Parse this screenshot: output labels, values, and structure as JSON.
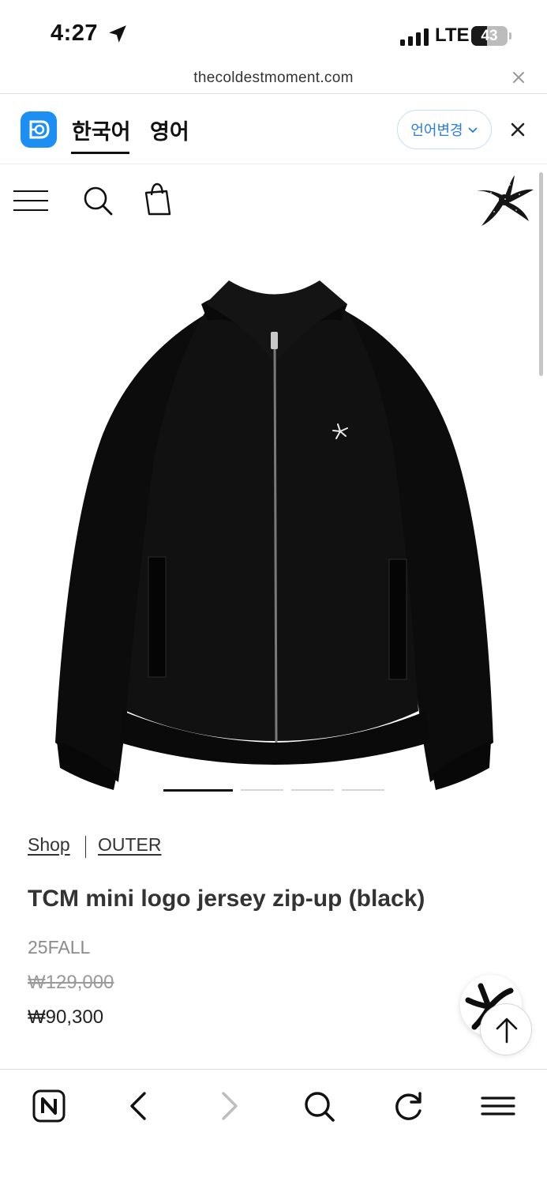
{
  "status_bar": {
    "time": "4:27",
    "network": "LTE",
    "battery": "43",
    "battery_level": 0.43
  },
  "url_bar": {
    "url": "thecoldestmoment.com"
  },
  "translate_bar": {
    "tabs": [
      "한국어",
      "영어"
    ],
    "active_tab": "한국어",
    "change_language": "언어변경"
  },
  "site_header": {
    "icons": [
      "menu-icon",
      "search-icon",
      "shopping-bag-icon",
      "starfish-logo"
    ]
  },
  "gallery": {
    "slides": 4,
    "active_slide": 1
  },
  "product": {
    "breadcrumb": [
      "Shop",
      "OUTER"
    ],
    "title": "TCM mini logo jersey zip-up (black)",
    "season": "25FALL",
    "original_price": "₩129,000",
    "sale_price": "₩90,300"
  },
  "bottom_toolbar": {
    "icons": [
      "naver-icon",
      "back-icon",
      "forward-icon",
      "search-icon",
      "reload-icon",
      "menu-icon"
    ]
  },
  "colors": {
    "accent": "#1e8ff2",
    "lang_change_text": "#2a7de1",
    "text": "#333333",
    "muted": "#8a8a8a"
  }
}
